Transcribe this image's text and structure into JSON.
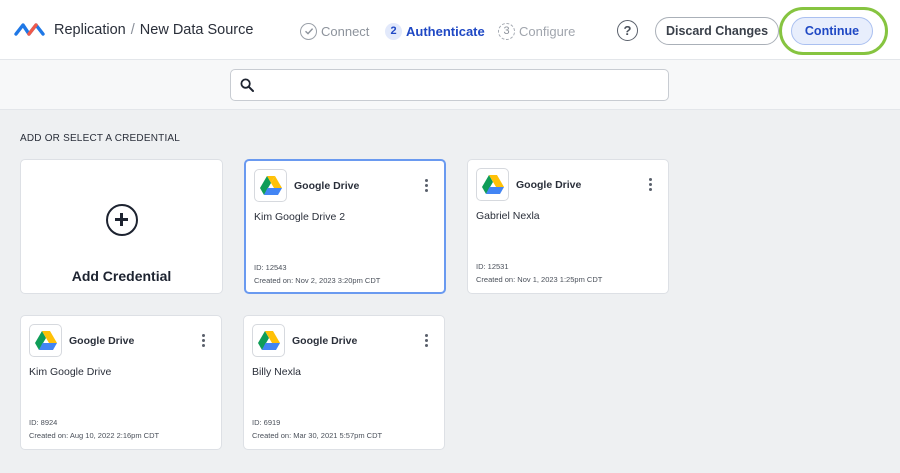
{
  "header": {
    "breadcrumb_root": "Replication",
    "breadcrumb_separator": "/",
    "breadcrumb_current": "New Data Source",
    "steps": [
      {
        "number": "1",
        "label": "Connect",
        "state": "complete"
      },
      {
        "number": "2",
        "label": "Authenticate",
        "state": "active"
      },
      {
        "number": "3",
        "label": "Configure",
        "state": "upcoming"
      }
    ],
    "help_icon": "?",
    "discard_label": "Discard Changes",
    "continue_label": "Continue"
  },
  "search": {
    "value": "",
    "icon": "search-icon"
  },
  "section": {
    "label": "ADD OR SELECT A CREDENTIAL",
    "add_label": "Add Credential"
  },
  "credentials": [
    {
      "service": "Google Drive",
      "name": "Kim Google Drive 2",
      "id": "ID: 12543",
      "created": "Created on: Nov 2, 2023 3:20pm CDT",
      "selected": true
    },
    {
      "service": "Google Drive",
      "name": "Gabriel Nexla",
      "id": "ID: 12531",
      "created": "Created on: Nov 1, 2023 1:25pm CDT",
      "selected": false
    },
    {
      "service": "Google Drive",
      "name": "Kim Google Drive",
      "id": "ID: 8924",
      "created": "Created on: Aug 10, 2022 2:16pm CDT",
      "selected": false
    },
    {
      "service": "Google Drive",
      "name": "Billy Nexla",
      "id": "ID: 6919",
      "created": "Created on: Mar 30, 2021 5:57pm CDT",
      "selected": false
    }
  ],
  "colors": {
    "accent": "#1f48c4",
    "highlight_ring": "#86c440",
    "selected_border": "#6a9af0"
  }
}
